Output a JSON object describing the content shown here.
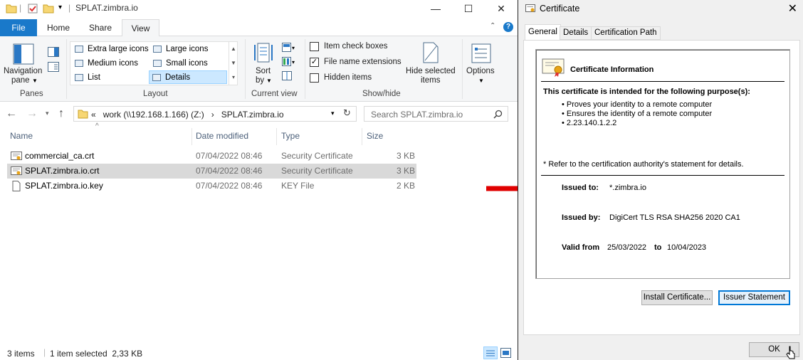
{
  "explorer": {
    "title": "SPLAT.zimbra.io",
    "tabs": [
      {
        "label": "File"
      },
      {
        "label": "Home"
      },
      {
        "label": "Share"
      },
      {
        "label": "View"
      }
    ],
    "ribbon": {
      "panes": {
        "nav_pane_line1": "Navigation",
        "nav_pane_line2": "pane",
        "group": "Panes"
      },
      "layout": {
        "items": [
          "Extra large icons",
          "Large icons",
          "Medium icons",
          "Small icons",
          "List",
          "Details"
        ],
        "selected": "Details",
        "group": "Layout"
      },
      "current_view": {
        "sort_line1": "Sort",
        "sort_line2": "by",
        "group": "Current view"
      },
      "show_hide": {
        "item_check_boxes": "Item check boxes",
        "file_name_extensions": "File name extensions",
        "hidden_items": "Hidden items",
        "hide_selected_line1": "Hide selected",
        "hide_selected_line2": "items",
        "group": "Show/hide"
      },
      "options": {
        "label": "Options"
      }
    },
    "address": {
      "prefix": "«",
      "crumb1": "work (\\\\192.168.1.166) (Z:)",
      "sep": "›",
      "crumb2": "SPLAT.zimbra.io"
    },
    "search": {
      "placeholder": "Search SPLAT.zimbra.io"
    },
    "columns": {
      "name": "Name",
      "date": "Date modified",
      "type": "Type",
      "size": "Size"
    },
    "files": [
      {
        "name": "commercial_ca.crt",
        "date": "07/04/2022 08:46",
        "type": "Security Certificate",
        "size": "3 KB"
      },
      {
        "name": "SPLAT.zimbra.io.crt",
        "date": "07/04/2022 08:46",
        "type": "Security Certificate",
        "size": "3 KB"
      },
      {
        "name": "SPLAT.zimbra.io.key",
        "date": "07/04/2022 08:46",
        "type": "KEY File",
        "size": "2 KB"
      }
    ],
    "status": {
      "items": "3 items",
      "selected": "1 item selected  2,33 KB"
    }
  },
  "certificate": {
    "title": "Certificate",
    "tabs": [
      {
        "label": "General"
      },
      {
        "label": "Details"
      },
      {
        "label": "Certification Path"
      }
    ],
    "info_heading": "Certificate Information",
    "purpose_heading": "This certificate is intended for the following purpose(s):",
    "purposes": [
      "• Proves your identity to a remote computer",
      "• Ensures the identity of a remote computer",
      "• 2.23.140.1.2.2"
    ],
    "note": "* Refer to the certification authority's statement for details.",
    "issued_to_label": "Issued to:",
    "issued_to": "*.zimbra.io",
    "issued_by_label": "Issued by:",
    "issued_by": "DigiCert TLS RSA SHA256 2020 CA1",
    "valid_from_label": "Valid from",
    "valid_from": "25/03/2022",
    "valid_to_label": "to",
    "valid_to": "10/04/2023",
    "install_button": "Install Certificate...",
    "issuer_button": "Issuer Statement",
    "ok_button": "OK"
  },
  "colors": {
    "file_tab": "#1979ca",
    "selection": "#cce8ff",
    "arrow": "#e00000",
    "focus": "#0078d7"
  }
}
